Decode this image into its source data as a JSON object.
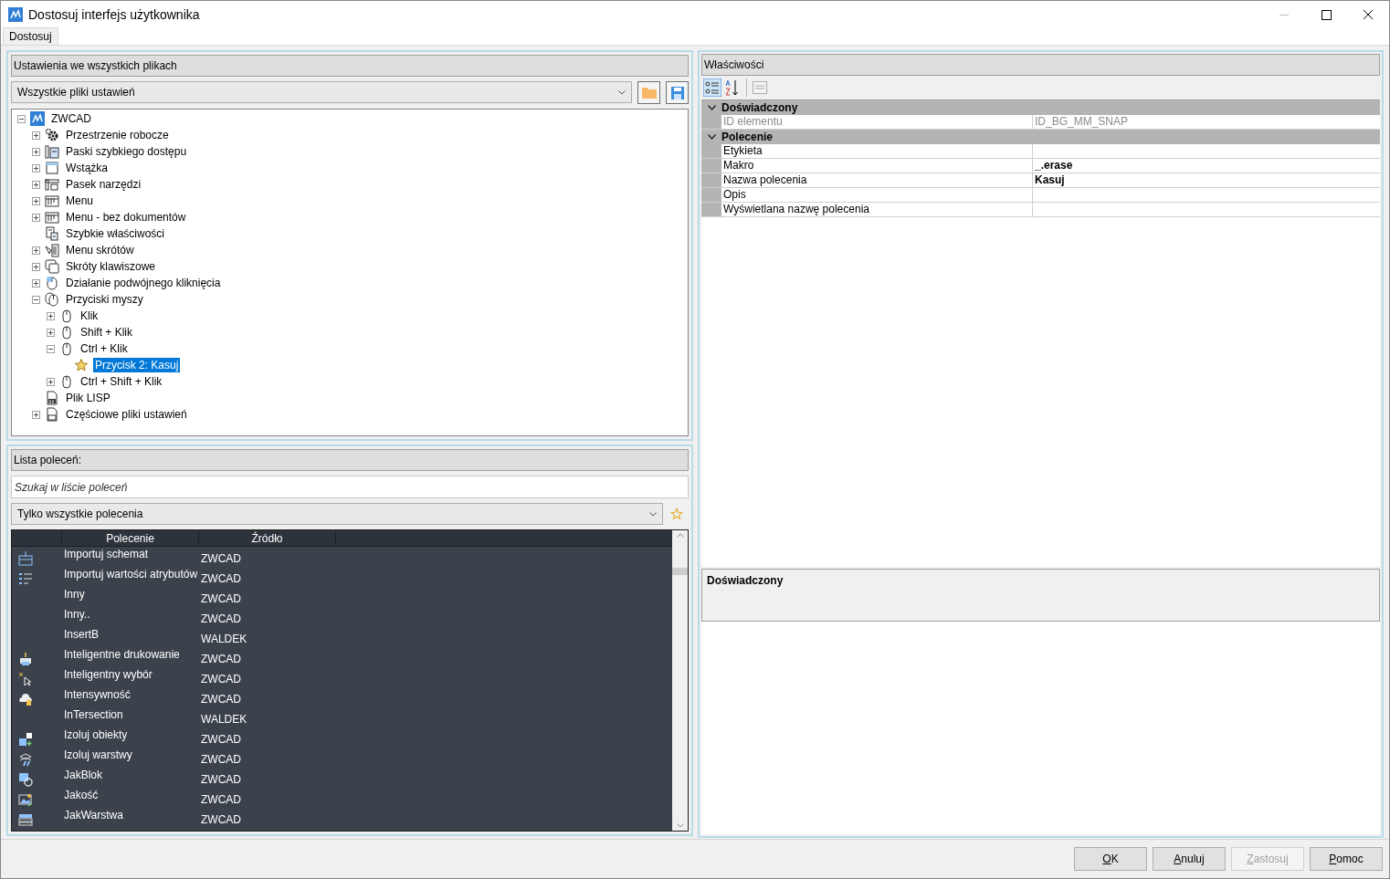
{
  "window": {
    "title": "Dostosuj interfejs użytkownika"
  },
  "tabs": [
    {
      "label": "Dostosuj",
      "selected": true
    }
  ],
  "settings_panel": {
    "title": "Ustawienia we wszystkich plikach",
    "file_dropdown": "Wszystkie pliki ustawień",
    "tree": [
      {
        "label": "ZWCAD",
        "kind": "app",
        "expanded": true,
        "selected": false,
        "children": [
          {
            "label": "Przestrzenie robocze",
            "kind": "gear",
            "expanded": false,
            "selected": false
          },
          {
            "label": "Paski szybkiego dostępu",
            "kind": "quickbar",
            "expanded": false,
            "selected": false
          },
          {
            "label": "Wstążka",
            "kind": "ribbon",
            "expanded": false,
            "selected": false
          },
          {
            "label": "Pasek narzędzi",
            "kind": "toolbar",
            "expanded": false,
            "selected": false
          },
          {
            "label": "Menu",
            "kind": "menu",
            "expanded": false,
            "selected": false
          },
          {
            "label": "Menu - bez dokumentów",
            "kind": "menu",
            "expanded": false,
            "selected": false
          },
          {
            "label": "Szybkie właściwości",
            "kind": "props",
            "selected": false
          },
          {
            "label": "Menu skrótów",
            "kind": "context",
            "expanded": false,
            "selected": false
          },
          {
            "label": "Skróty klawiszowe",
            "kind": "keys",
            "expanded": false,
            "selected": false
          },
          {
            "label": "Działanie podwójnego kliknięcia",
            "kind": "dblclick",
            "expanded": false,
            "selected": false
          },
          {
            "label": "Przyciski myszy",
            "kind": "mice",
            "expanded": true,
            "selected": false,
            "children": [
              {
                "label": "Klik",
                "kind": "mouse",
                "expanded": false,
                "selected": false
              },
              {
                "label": "Shift + Klik",
                "kind": "mouse",
                "expanded": false,
                "selected": false
              },
              {
                "label": "Ctrl + Klik",
                "kind": "mouse",
                "expanded": true,
                "selected": false,
                "children": [
                  {
                    "label": "Przycisk 2: Kasuj",
                    "kind": "star",
                    "selected": true
                  }
                ]
              },
              {
                "label": "Ctrl + Shift + Klik",
                "kind": "mouse",
                "expanded": false,
                "selected": false
              }
            ]
          },
          {
            "label": "Plik LISP",
            "kind": "lisp",
            "selected": false
          },
          {
            "label": "Częściowe pliki ustawień",
            "kind": "partial",
            "expanded": false,
            "selected": false
          }
        ]
      }
    ]
  },
  "command_panel": {
    "title": "Lista poleceń:",
    "search": {
      "placeholder": "Szukaj w liście poleceń"
    },
    "filter_dropdown": "Tylko wszystkie polecenia",
    "columns": [
      "Polecenie",
      "Źródło"
    ],
    "rows": [
      {
        "kind": "gis",
        "name": "Importuj schemat",
        "source": "ZWCAD"
      },
      {
        "kind": "list",
        "name": "Importuj wartości atrybutów",
        "source": "ZWCAD"
      },
      {
        "kind": "none",
        "name": "Inny",
        "source": "ZWCAD"
      },
      {
        "kind": "none",
        "name": "Inny..",
        "source": "ZWCAD"
      },
      {
        "kind": "none",
        "name": "InsertB",
        "source": "WALDEK"
      },
      {
        "kind": "print",
        "name": "Inteligentne drukowanie",
        "source": "ZWCAD"
      },
      {
        "kind": "select",
        "name": "Inteligentny wybór",
        "source": "ZWCAD"
      },
      {
        "kind": "cloud",
        "name": "Intensywność",
        "source": "ZWCAD"
      },
      {
        "kind": "none",
        "name": "InTersection",
        "source": "WALDEK"
      },
      {
        "kind": "isolate",
        "name": "Izoluj obiekty",
        "source": "ZWCAD"
      },
      {
        "kind": "layers",
        "name": "Izoluj warstwy",
        "source": "ZWCAD"
      },
      {
        "kind": "block",
        "name": "JakBlok",
        "source": "ZWCAD"
      },
      {
        "kind": "image",
        "name": "Jakość",
        "source": "ZWCAD"
      },
      {
        "kind": "stack",
        "name": "JakWarstwa",
        "source": "ZWCAD"
      }
    ]
  },
  "properties_panel": {
    "title": "Właściwości",
    "categories": [
      {
        "name": "Doświadczony",
        "expanded": true,
        "rows": [
          {
            "label": "ID elementu",
            "value": "ID_BG_MM_SNAP",
            "readonly": true,
            "bold": false
          }
        ]
      },
      {
        "name": "Polecenie",
        "expanded": true,
        "rows": [
          {
            "label": "Etykieta",
            "readonly": false
          },
          {
            "label": "Makro",
            "value": "_.erase",
            "readonly": false,
            "bold": true
          },
          {
            "label": "Nazwa polecenia",
            "value": "Kasuj",
            "readonly": false,
            "bold": true
          },
          {
            "label": "Opis",
            "readonly": false
          },
          {
            "label": "Wyświetlana nazwę polecenia",
            "readonly": false
          }
        ]
      }
    ],
    "description": {
      "title": "Doświadczony"
    }
  },
  "buttons": [
    {
      "label": "OK",
      "disabled": false
    },
    {
      "label": "Anuluj",
      "disabled": false
    },
    {
      "label": "Zastosuj",
      "disabled": true
    },
    {
      "label": "Pomoc",
      "disabled": false
    }
  ]
}
